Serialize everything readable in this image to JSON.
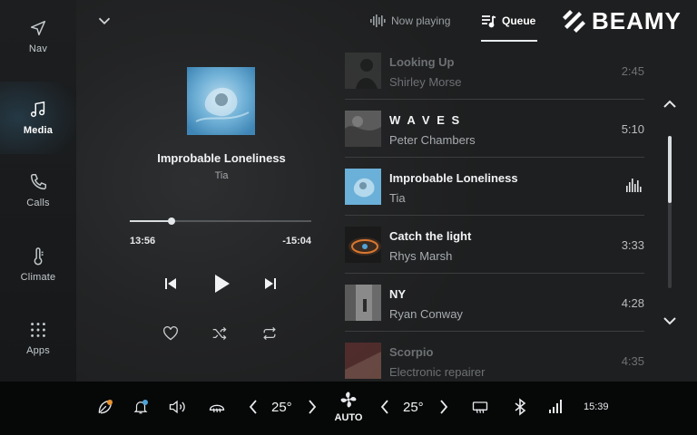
{
  "sidebar": {
    "items": [
      {
        "label": "Nav",
        "icon": "navigation-arrow-icon"
      },
      {
        "label": "Media",
        "icon": "music-note-icon",
        "active": true
      },
      {
        "label": "Calls",
        "icon": "phone-icon"
      },
      {
        "label": "Climate",
        "icon": "thermometer-icon"
      },
      {
        "label": "Apps",
        "icon": "grid-icon"
      }
    ]
  },
  "header": {
    "tabs": [
      {
        "label": "Now playing",
        "icon": "waveform-icon"
      },
      {
        "label": "Queue",
        "icon": "queue-list-icon",
        "active": true
      }
    ],
    "brand": "BEAMY"
  },
  "now_playing": {
    "title": "Improbable Loneliness",
    "artist": "Tia",
    "elapsed": "13:56",
    "remaining": "-15:04",
    "progress": 0.23
  },
  "queue": [
    {
      "title": "Looking Up",
      "artist": "Shirley Morse",
      "duration": "2:45",
      "faded": true
    },
    {
      "title": "W A V E S",
      "artist": "Peter Chambers",
      "duration": "5:10"
    },
    {
      "title": "Improbable Loneliness",
      "artist": "Tia",
      "duration": "",
      "playing": true
    },
    {
      "title": "Catch the light",
      "artist": "Rhys Marsh",
      "duration": "3:33"
    },
    {
      "title": "NY",
      "artist": "Ryan Conway",
      "duration": "4:28"
    },
    {
      "title": "Scorpio",
      "artist": "Electronic repairer",
      "duration": "4:35",
      "faded": true
    }
  ],
  "bottom_bar": {
    "temp_left": "25°",
    "temp_right": "25°",
    "fan_mode": "AUTO",
    "clock": "15:39"
  },
  "colors": {
    "accent_orange": "#e8922e",
    "accent_blue": "#4fa3d6",
    "background": "#0b0c0d"
  }
}
